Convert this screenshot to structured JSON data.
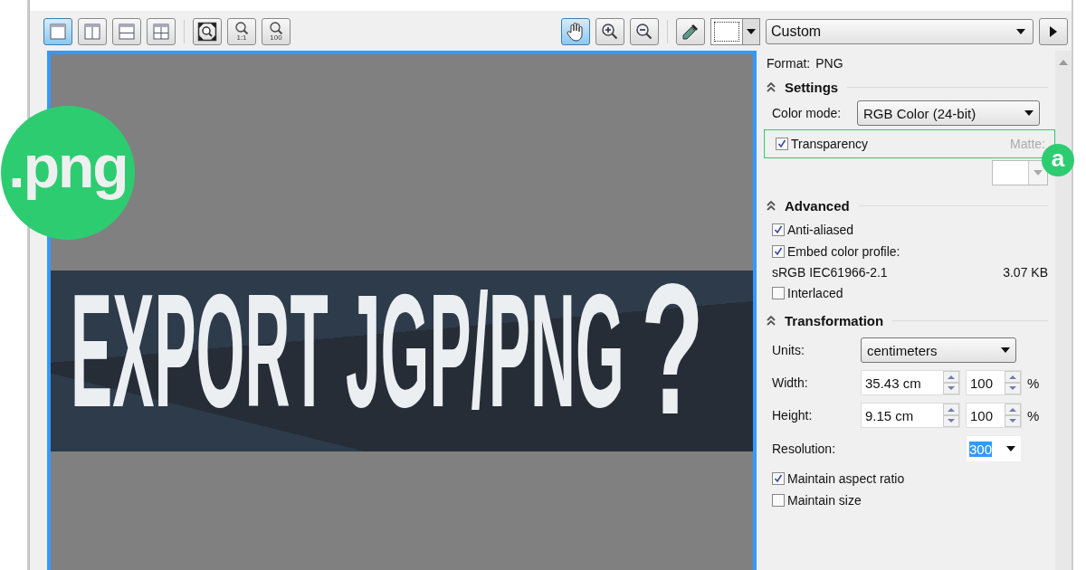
{
  "toolbar": {
    "view_buttons": [
      {
        "kind": "single",
        "selected": true
      },
      {
        "kind": "vertical",
        "selected": false
      },
      {
        "kind": "horizontal",
        "selected": false
      },
      {
        "kind": "quad",
        "selected": false
      }
    ],
    "zoom_buttons": [
      {
        "kind": "fit"
      },
      {
        "kind": "actual",
        "label": "1:1"
      },
      {
        "kind": "hundred",
        "label": "100"
      }
    ],
    "tools": [
      {
        "kind": "hand",
        "selected": true
      },
      {
        "kind": "zoom-in",
        "selected": false
      },
      {
        "kind": "zoom-out",
        "selected": false
      }
    ],
    "preset": "Custom"
  },
  "preview": {
    "headline": "EXPORT JGP/PNG",
    "mark": "?"
  },
  "badge": ".png",
  "callout": "a",
  "panel": {
    "format_label": "Format:",
    "format_value": "PNG",
    "settings": {
      "title": "Settings",
      "expanded": true,
      "color_mode_label": "Color mode:",
      "color_mode": "RGB Color (24-bit)",
      "transparency": {
        "label": "Transparency",
        "checked": true
      },
      "matte_label": "Matte:",
      "matte_disabled": true
    },
    "advanced": {
      "title": "Advanced",
      "expanded": true,
      "anti_aliased": {
        "label": "Anti-aliased",
        "checked": true
      },
      "embed_profile": {
        "label": "Embed color profile:",
        "checked": true
      },
      "profile": "sRGB IEC61966-2.1",
      "file_size": "3.07 KB",
      "interlaced": {
        "label": "Interlaced",
        "checked": false
      }
    },
    "transformation": {
      "title": "Transformation",
      "expanded": true,
      "units_label": "Units:",
      "units": "centimeters",
      "width_label": "Width:",
      "width": "35.43 cm",
      "width_percent": "100",
      "height_label": "Height:",
      "height": "9.15 cm",
      "height_percent": "100",
      "percent_sign_1": "%",
      "percent_sign_2": "%",
      "resolution_label": "Resolution:",
      "resolution": "300",
      "resolution_highlighted": true,
      "maintain_aspect": {
        "label": "Maintain aspect ratio",
        "checked": true
      },
      "maintain_size": {
        "label": "Maintain size",
        "checked": false
      }
    }
  }
}
